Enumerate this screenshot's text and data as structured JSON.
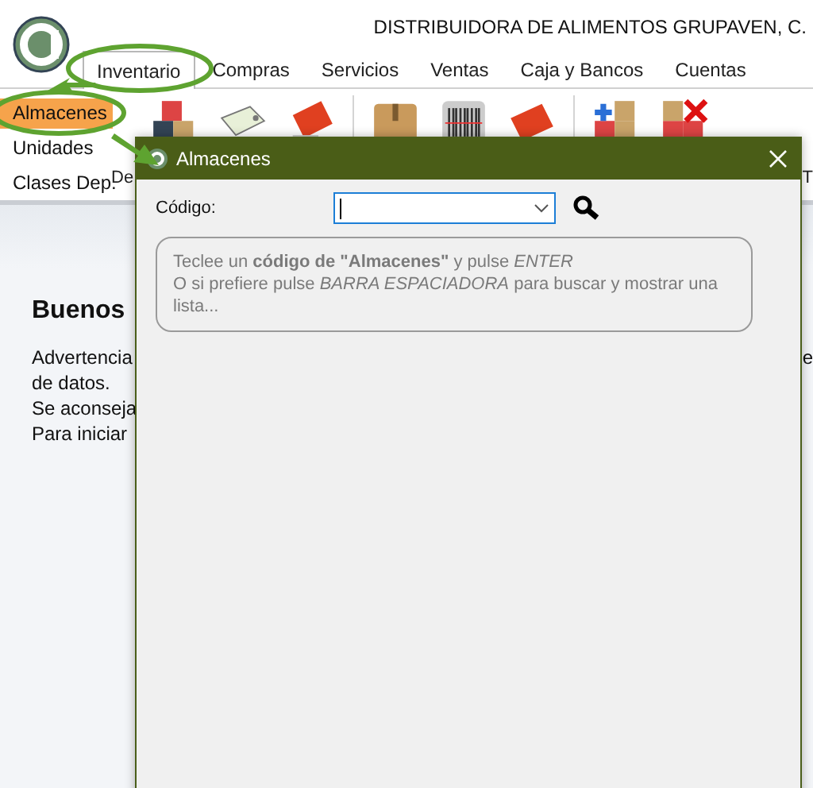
{
  "window": {
    "title": "DISTRIBUIDORA DE ALIMENTOS GRUPAVEN, C."
  },
  "tabs": [
    {
      "label": "Inventario",
      "selected": true
    },
    {
      "label": "Compras",
      "selected": false
    },
    {
      "label": "Servicios",
      "selected": false
    },
    {
      "label": "Ventas",
      "selected": false
    },
    {
      "label": "Caja y Bancos",
      "selected": false
    },
    {
      "label": "Cuentas",
      "selected": false
    }
  ],
  "side_menu": [
    {
      "label": "Almacenes",
      "selected": true
    },
    {
      "label": "Unidades",
      "selected": false
    },
    {
      "label": "Clases Dep.",
      "selected": false
    }
  ],
  "toolbar_captions": [
    "De",
    "T"
  ],
  "welcome": {
    "heading": "Buenos",
    "lines": [
      "Advertencia",
      "de datos.",
      "Se aconseja",
      "Para iniciar"
    ],
    "right_fragment": "e"
  },
  "dialog": {
    "title": "Almacenes",
    "field_label": "Código:",
    "hint_lines": [
      "Teclee un **código de \"Almacenes\"** y pulse *ENTER*",
      "O si prefiere pulse *BARRA ESPACIADORA* para buscar y mostrar una lista..."
    ]
  }
}
